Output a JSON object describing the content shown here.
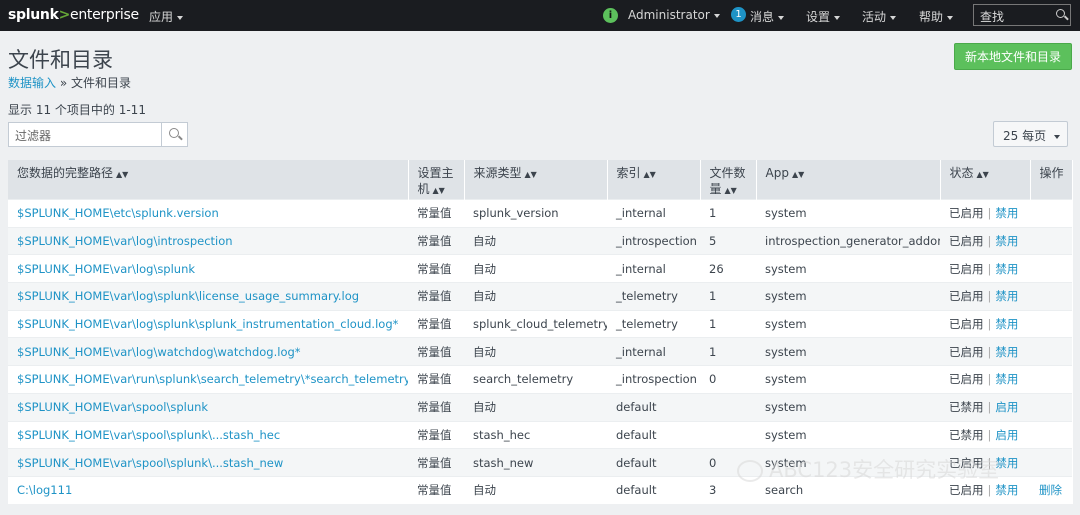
{
  "nav": {
    "logo_a": "splunk",
    "logo_b": ">",
    "logo_c": "enterprise",
    "apps": "应用",
    "user": "Administrator",
    "messages_count": "1",
    "messages": "消息",
    "settings": "设置",
    "activity": "活动",
    "help": "帮助",
    "search": "查找"
  },
  "page": {
    "title": "文件和目录",
    "breadcrumb_link": "数据输入",
    "breadcrumb_sep": "»",
    "breadcrumb_current": "文件和目录",
    "new_button": "新本地文件和目录",
    "count_text": "显示 11 个项目中的 1-11",
    "filter_placeholder": "过滤器",
    "per_page": "25 每页"
  },
  "table": {
    "headers": [
      "您数据的完整路径",
      "设置主机",
      "来源类型",
      "索引",
      "文件数量",
      "App",
      "状态",
      "操作"
    ],
    "rows": [
      {
        "path": "$SPLUNK_HOME\\etc\\splunk.version",
        "host": "常量值",
        "sourcetype": "splunk_version",
        "index": "_internal",
        "files": "1",
        "app": "system",
        "status": "已启用",
        "action": "禁用",
        "delete": ""
      },
      {
        "path": "$SPLUNK_HOME\\var\\log\\introspection",
        "host": "常量值",
        "sourcetype": "自动",
        "index": "_introspection",
        "files": "5",
        "app": "introspection_generator_addon",
        "status": "已启用",
        "action": "禁用",
        "delete": ""
      },
      {
        "path": "$SPLUNK_HOME\\var\\log\\splunk",
        "host": "常量值",
        "sourcetype": "自动",
        "index": "_internal",
        "files": "26",
        "app": "system",
        "status": "已启用",
        "action": "禁用",
        "delete": ""
      },
      {
        "path": "$SPLUNK_HOME\\var\\log\\splunk\\license_usage_summary.log",
        "host": "常量值",
        "sourcetype": "自动",
        "index": "_telemetry",
        "files": "1",
        "app": "system",
        "status": "已启用",
        "action": "禁用",
        "delete": ""
      },
      {
        "path": "$SPLUNK_HOME\\var\\log\\splunk\\splunk_instrumentation_cloud.log*",
        "host": "常量值",
        "sourcetype": "splunk_cloud_telemetry",
        "index": "_telemetry",
        "files": "1",
        "app": "system",
        "status": "已启用",
        "action": "禁用",
        "delete": ""
      },
      {
        "path": "$SPLUNK_HOME\\var\\log\\watchdog\\watchdog.log*",
        "host": "常量值",
        "sourcetype": "自动",
        "index": "_internal",
        "files": "1",
        "app": "system",
        "status": "已启用",
        "action": "禁用",
        "delete": ""
      },
      {
        "path": "$SPLUNK_HOME\\var\\run\\splunk\\search_telemetry\\*search_telemetry.json",
        "host": "常量值",
        "sourcetype": "search_telemetry",
        "index": "_introspection",
        "files": "0",
        "app": "system",
        "status": "已启用",
        "action": "禁用",
        "delete": ""
      },
      {
        "path": "$SPLUNK_HOME\\var\\spool\\splunk",
        "host": "常量值",
        "sourcetype": "自动",
        "index": "default",
        "files": "",
        "app": "system",
        "status": "已禁用",
        "action": "启用",
        "delete": ""
      },
      {
        "path": "$SPLUNK_HOME\\var\\spool\\splunk\\...stash_hec",
        "host": "常量值",
        "sourcetype": "stash_hec",
        "index": "default",
        "files": "",
        "app": "system",
        "status": "已禁用",
        "action": "启用",
        "delete": ""
      },
      {
        "path": "$SPLUNK_HOME\\var\\spool\\splunk\\...stash_new",
        "host": "常量值",
        "sourcetype": "stash_new",
        "index": "default",
        "files": "0",
        "app": "system",
        "status": "已启用",
        "action": "禁用",
        "delete": ""
      },
      {
        "path": "C:\\log111",
        "host": "常量值",
        "sourcetype": "自动",
        "index": "default",
        "files": "3",
        "app": "search",
        "status": "已启用",
        "action": "禁用",
        "delete": "删除"
      }
    ]
  },
  "watermark": "ABC123安全研究实验室"
}
